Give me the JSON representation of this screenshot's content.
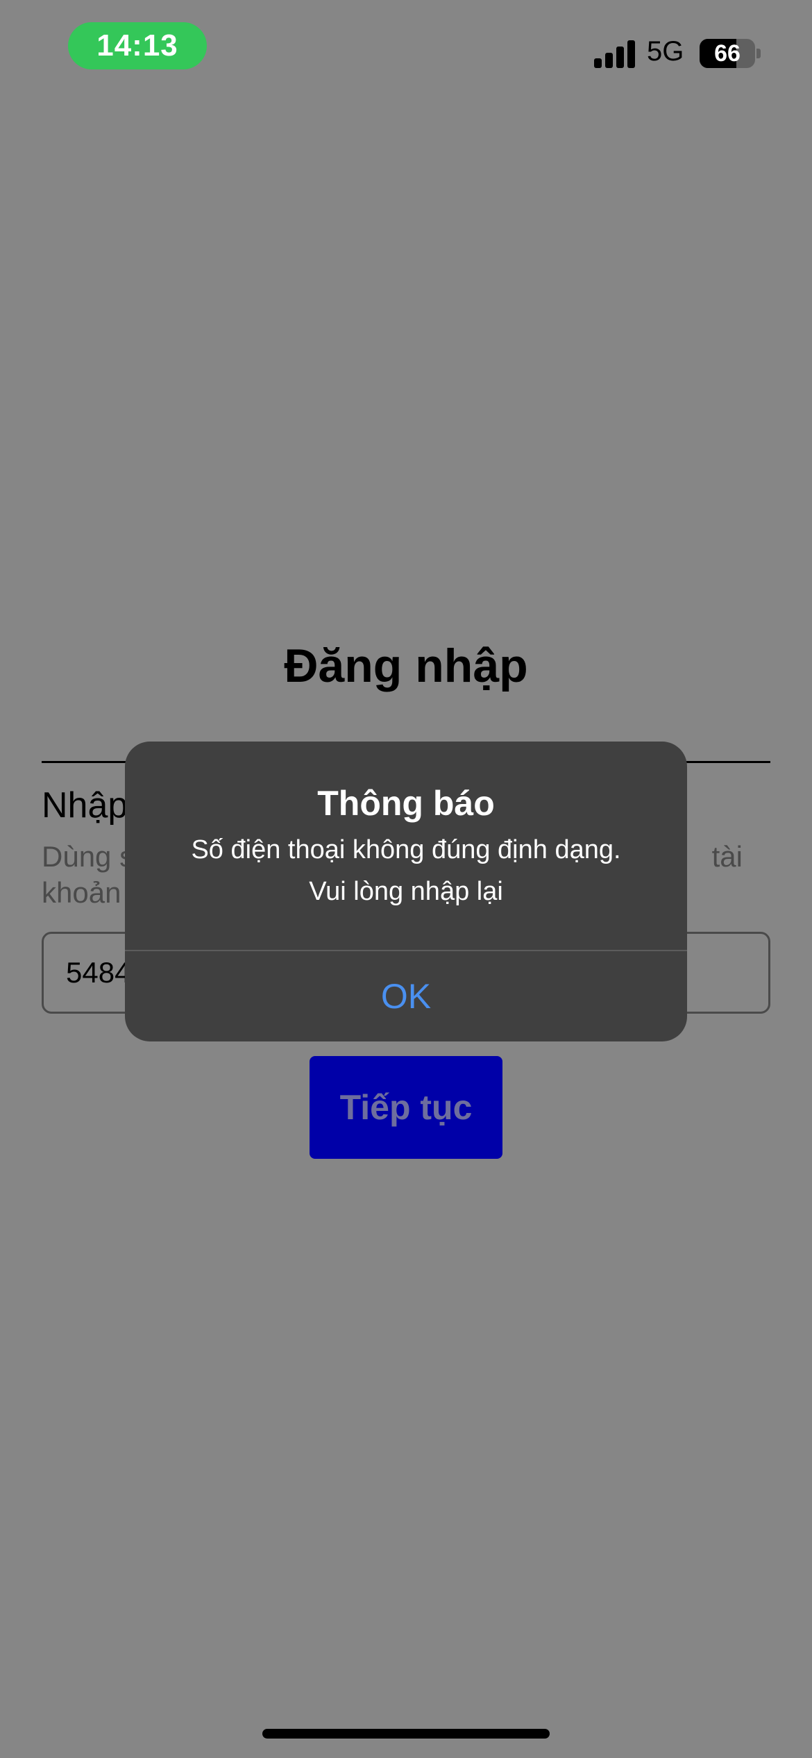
{
  "status_bar": {
    "time": "14:13",
    "network": "5G",
    "battery_level": "66",
    "signal_icon": "signal-bars-icon",
    "battery_icon": "battery-icon"
  },
  "login": {
    "title": "Đăng nhập",
    "section_heading": "Nhập",
    "section_desc_line1": "Dùng s",
    "section_desc_line1_end": "tài",
    "section_desc_line2": "khoản",
    "phone_value": "5484"
  },
  "continue_button": {
    "label": "Tiếp tục"
  },
  "alert": {
    "title": "Thông báo",
    "message_line1": "Số điện thoại không đúng định dạng.",
    "message_line2": "Vui lòng nhập lại",
    "ok_label": "OK"
  },
  "colors": {
    "dim_background": "#868686",
    "time_pill": "#34c759",
    "alert_background": "#404040",
    "alert_action": "#4a90f0",
    "button_background": "#0000a8"
  }
}
